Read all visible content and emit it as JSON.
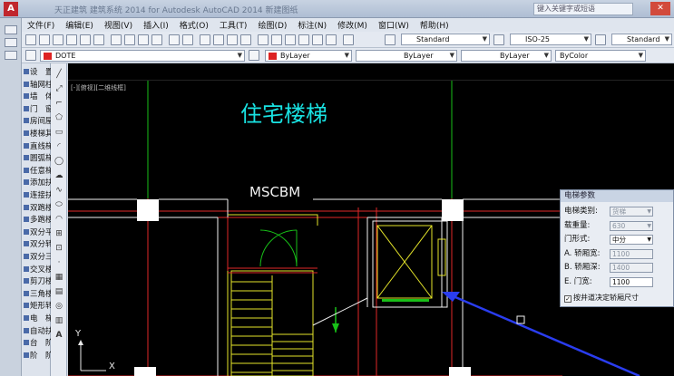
{
  "window": {
    "title": "天正建筑 建筑系统 2014  for Autodesk AutoCAD 2014    新建图纸",
    "search_placeholder": "键入关键字或短语",
    "close_glyph": "✕",
    "logo_letter": "A"
  },
  "menu": [
    "文件(F)",
    "编辑(E)",
    "视图(V)",
    "插入(I)",
    "格式(O)",
    "工具(T)",
    "绘图(D)",
    "标注(N)",
    "修改(M)",
    "窗口(W)",
    "帮助(H)"
  ],
  "toolbar": {
    "text_style": "Standard",
    "dim_style": "ISO-25",
    "table_style": "Standard",
    "layer": "DOTE",
    "color": "ByLayer",
    "linetype": "ByLayer",
    "lineweight": "ByLayer",
    "plotstyle": "ByColor"
  },
  "viewport_label": "[-][俯视][二维线框]",
  "tiansheng_menu": [
    "设　置",
    "轴网柱子",
    "墙　体",
    "门　窗",
    "房间屋顶",
    "楼梯其他",
    "直线梯段",
    "圆弧梯段",
    "任意梯段",
    "添加扶手",
    "连接扶手",
    "双跑楼梯",
    "多跑楼梯",
    "双分平行",
    "双分转角",
    "双分三跑",
    "交叉楼梯",
    "剪刀楼梯",
    "三角楼梯",
    "矩形转角",
    "电　梯",
    "自动扶梯",
    "台　阶",
    "阶　阶"
  ],
  "drawing": {
    "title": "住宅楼梯",
    "room_label": "MSCBM",
    "ucs_x": "X",
    "ucs_y": "Y",
    "colors": {
      "axis_red": "#e02828",
      "wall_white": "#f2f2f2",
      "green": "#18c018",
      "yellow": "#e4e42a",
      "cyan_text": "#19e2e2",
      "arrow_blue": "#2a3df0"
    }
  },
  "dialog": {
    "title": "电梯参数",
    "rows": [
      {
        "label": "电梯类别:",
        "value": "货梯",
        "disabled": true,
        "dropdown": true
      },
      {
        "label": "载重量:",
        "value": "630",
        "disabled": true,
        "dropdown": true
      },
      {
        "label": "门形式:",
        "value": "中分",
        "disabled": false,
        "dropdown": true
      },
      {
        "label": "A. 轿厢宽:",
        "value": "1100",
        "disabled": true,
        "dropdown": false
      },
      {
        "label": "B. 轿厢深:",
        "value": "1400",
        "disabled": true,
        "dropdown": false
      },
      {
        "label": "E. 门宽:",
        "value": "1100",
        "disabled": false,
        "dropdown": false
      }
    ],
    "checkbox_label": "按井道决定轿厢尺寸",
    "checkbox_checked": true,
    "check_glyph": "✓",
    "dropdown_glyph": "▼"
  }
}
